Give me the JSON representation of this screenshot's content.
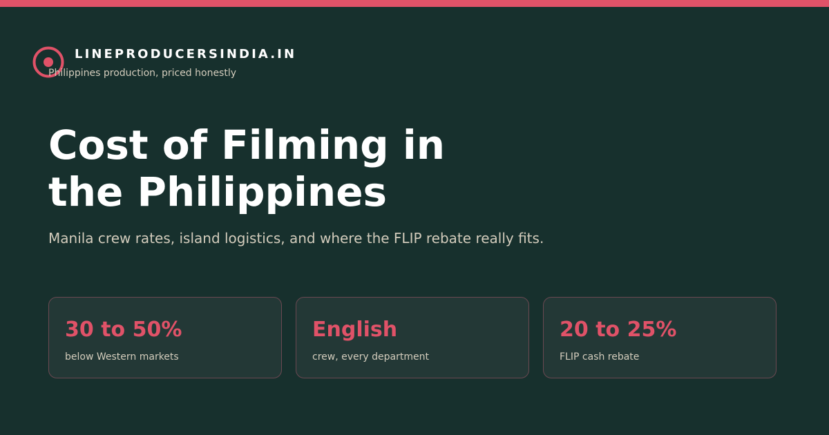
{
  "colors": {
    "background": "#17302D",
    "accent": "#E05268",
    "text_primary": "#FFFFFF",
    "text_muted": "#D3CCBC",
    "card_background": "#233836",
    "card_border": "#6B4952"
  },
  "brand": {
    "logo_icon": "target-icon",
    "name": "LINEPRODUCERSINDIA.IN",
    "tagline": "Philippines production, priced honestly"
  },
  "hero": {
    "title_line1": "Cost of Filming in",
    "title_line2": "the Philippines",
    "subtitle": "Manila crew rates, island logistics, and where the FLIP rebate really fits."
  },
  "stats": [
    {
      "value": "30 to 50%",
      "label": "below Western markets"
    },
    {
      "value": "English",
      "label": "crew, every department"
    },
    {
      "value": "20 to 25%",
      "label": "FLIP cash rebate"
    }
  ]
}
